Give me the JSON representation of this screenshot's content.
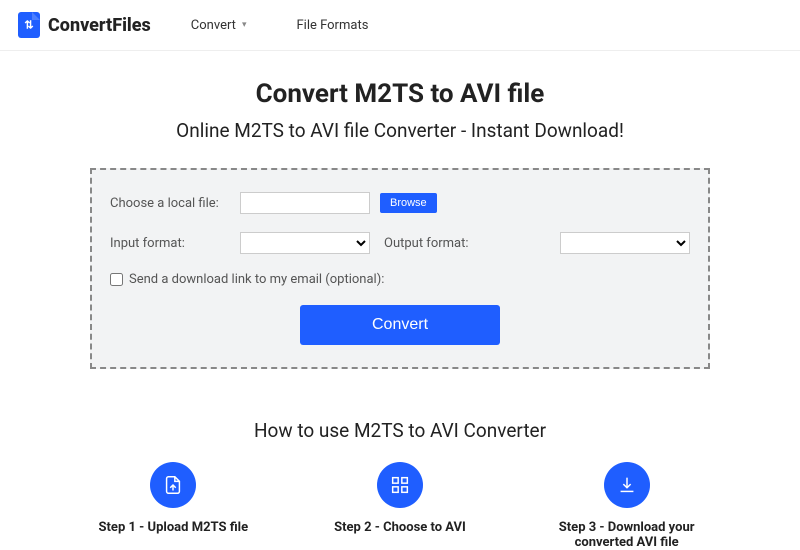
{
  "brand": "ConvertFiles",
  "nav": {
    "convert": "Convert",
    "formats": "File Formats"
  },
  "title": "Convert M2TS to AVI file",
  "subtitle": "Online M2TS to AVI file Converter - Instant Download!",
  "form": {
    "choose_label": "Choose a local file:",
    "browse": "Browse",
    "input_label": "Input format:",
    "output_label": "Output format:",
    "email_label": "Send a download link to my email (optional):",
    "convert": "Convert"
  },
  "howto": "How to use M2TS to AVI Converter",
  "steps": {
    "s1": "Step 1 - Upload M2TS file",
    "s2": "Step 2 - Choose to AVI",
    "s3": "Step 3 - Download your converted AVI file"
  }
}
